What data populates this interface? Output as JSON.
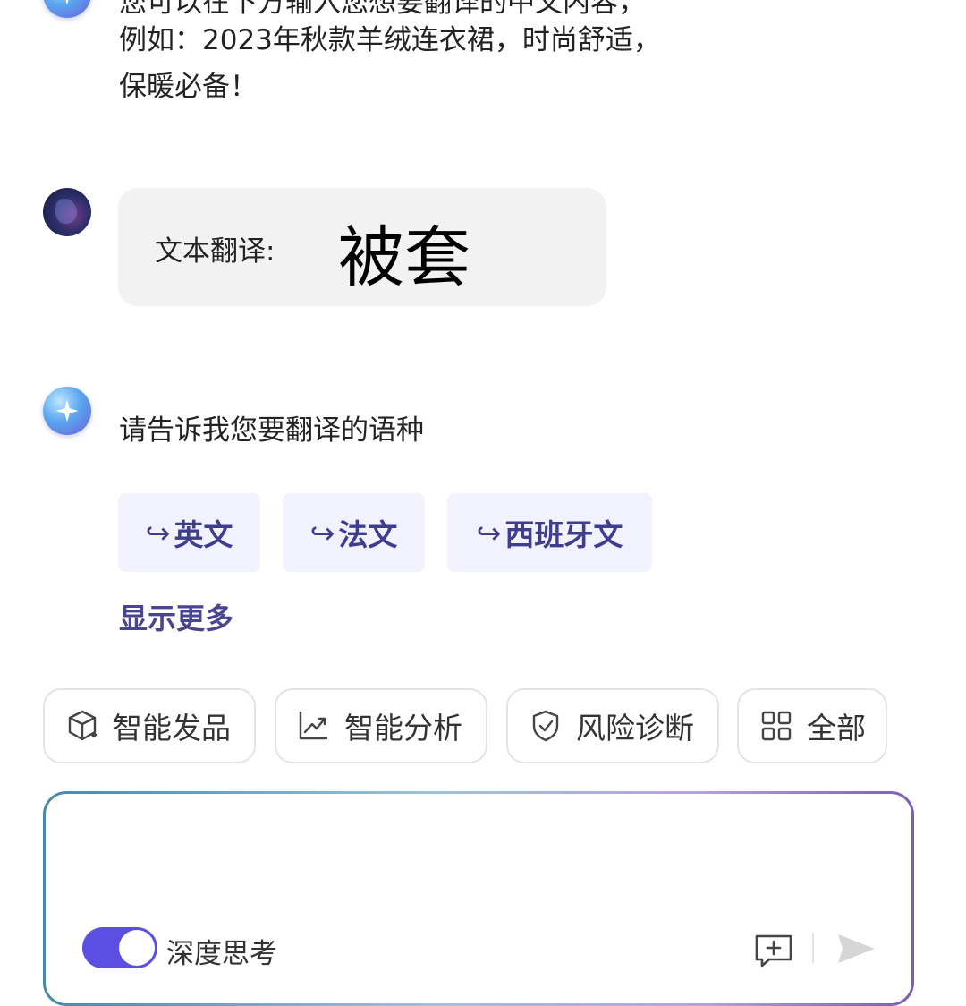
{
  "chat": {
    "bot_message_1": {
      "line_0": "您可以在下方输入您想要翻译的中文内容，",
      "line_1": "例如：2023年秋款羊绒连衣裙，时尚舒适，",
      "line_2": "保暖必备！"
    },
    "user_message": {
      "label": "文本翻译:",
      "value": "被套"
    },
    "bot_message_2": {
      "text": "请告诉我您要翻译的语种",
      "options": [
        {
          "arrow": "↪",
          "label": "英文"
        },
        {
          "arrow": "↪",
          "label": "法文"
        },
        {
          "arrow": "↪",
          "label": "西班牙文"
        }
      ],
      "show_more": "显示更多"
    }
  },
  "quick_actions": [
    {
      "label": "智能发品",
      "icon": "cube-icon"
    },
    {
      "label": "智能分析",
      "icon": "trend-chart-icon"
    },
    {
      "label": "风险诊断",
      "icon": "shield-check-icon"
    },
    {
      "label": "全部",
      "icon": "grid-icon"
    }
  ],
  "composer": {
    "input_value": "",
    "deep_think_label": "深度思考",
    "deep_think_enabled": true
  },
  "colors": {
    "accent": "#5a4fe0",
    "chip_bg": "#f2f2ff",
    "chip_text": "#3f3d8f"
  }
}
